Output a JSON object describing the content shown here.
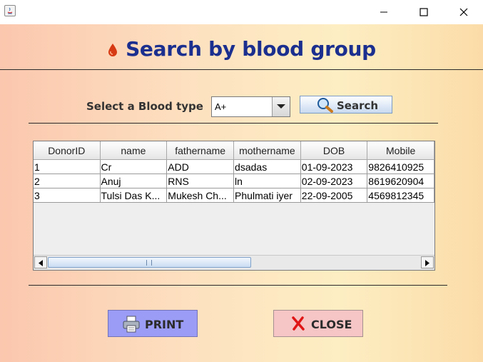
{
  "window": {
    "app_icon": "java-icon",
    "controls": [
      "minimize-icon",
      "maximize-icon",
      "close-icon"
    ]
  },
  "header": {
    "title": "Search by blood group",
    "icon": "blood-drop-icon"
  },
  "search": {
    "label": "Select a Blood type",
    "selected_blood_type": "A+",
    "button_label": "Search",
    "button_icon": "magnifier-icon"
  },
  "table": {
    "columns": [
      "DonorID",
      "name",
      "fathername",
      "mothername",
      "DOB",
      "Mobile"
    ],
    "rows": [
      [
        "1",
        "Cr",
        "ADD",
        "dsadas",
        "01-09-2023",
        "9826410925"
      ],
      [
        "2",
        "Anuj",
        "RNS",
        "ln",
        "02-09-2023",
        "8619620904"
      ],
      [
        "3",
        "Tulsi  Das K...",
        "Mukesh Ch...",
        "Phulmati iyer",
        "22-09-2005",
        "4569812345"
      ]
    ]
  },
  "actions": {
    "print_label": "PRINT",
    "print_icon": "printer-icon",
    "close_label": "CLOSE",
    "close_icon": "red-x-icon"
  },
  "colors": {
    "title": "#1b2f8f",
    "print_button": "#9b9cf5",
    "close_button": "#f6c5c5"
  }
}
